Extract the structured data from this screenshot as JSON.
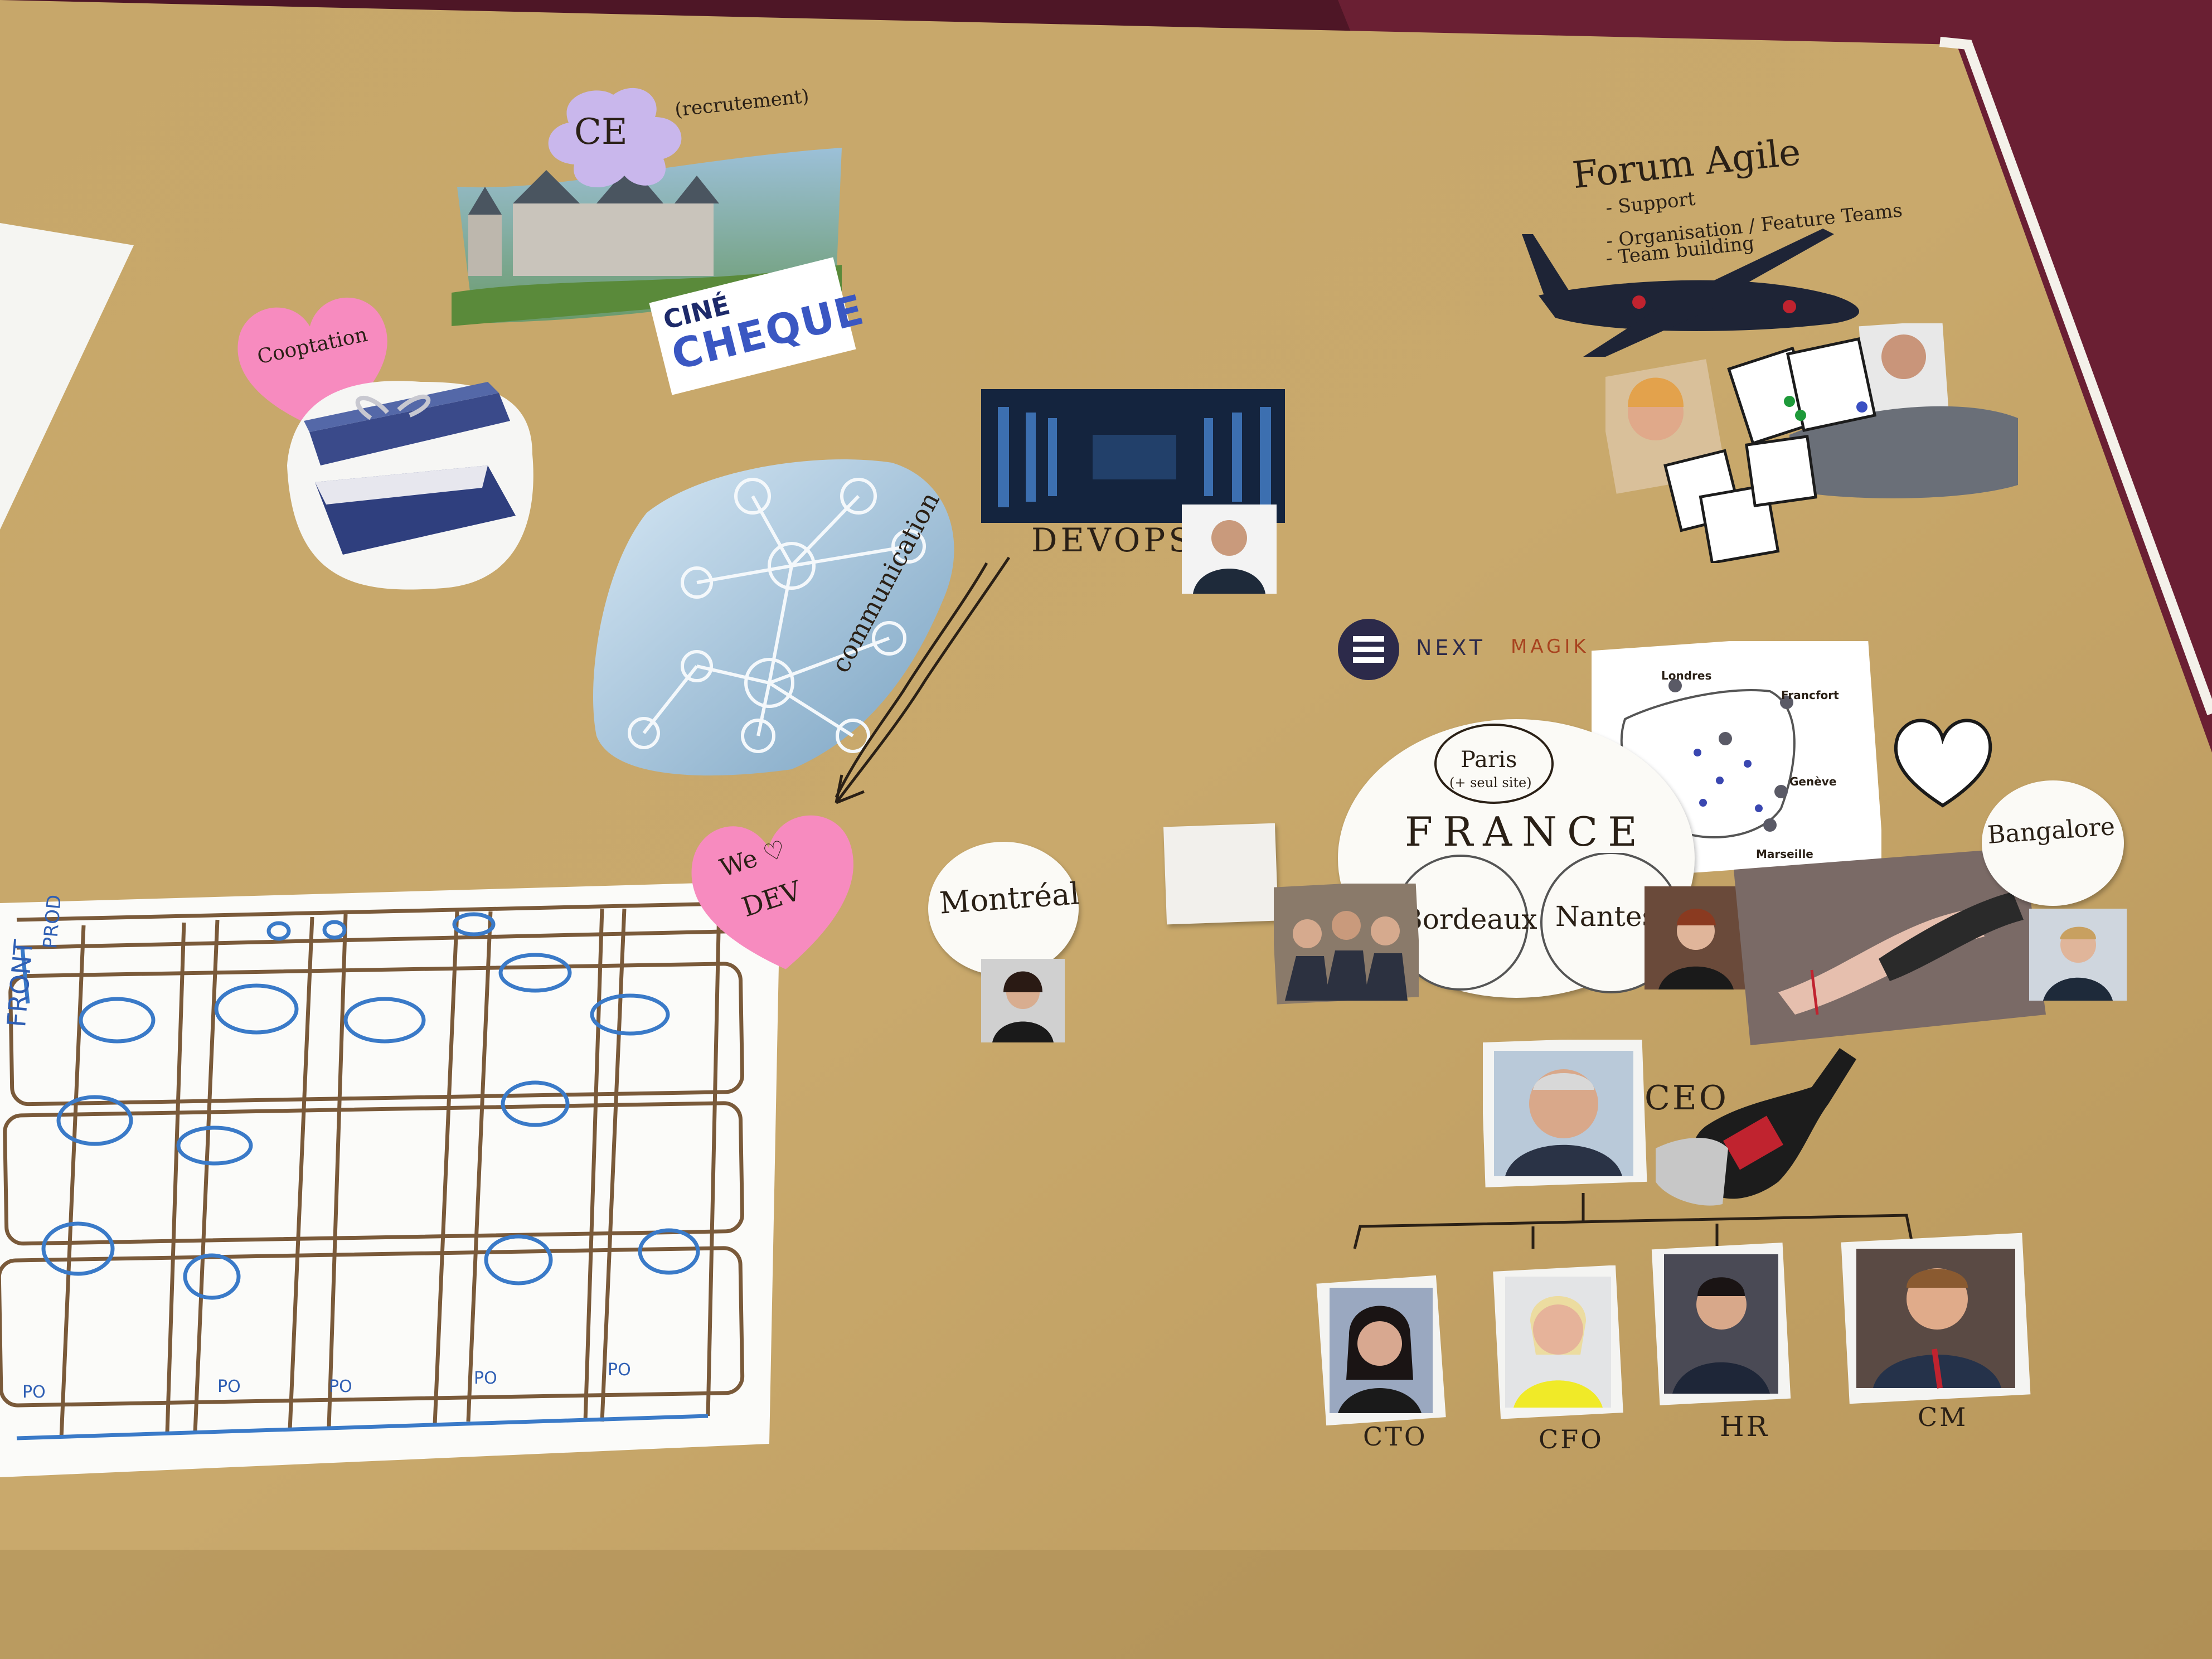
{
  "hr_board": {
    "ce": "CE",
    "ce_note": "(recrutement)",
    "cine_line1": "CINÉ",
    "cine_line2": "CHEQUE",
    "cooptation": "Cooptation",
    "communication": "communication",
    "we_love_dev_1": "We ♡",
    "we_love_dev_2": "DEV",
    "devops": "DEVOPS",
    "forum_title": "Forum Agile",
    "forum_items": [
      "- Support",
      "- Organisation / Feature Teams",
      "- Team building"
    ],
    "brand_next": "NEXT",
    "brand_magik": "MAGIK",
    "map_cities": [
      "Londres",
      "Francfort",
      "Genève",
      "Marseille"
    ],
    "paris": "Paris",
    "paris_note": "(+ seul site)",
    "france": "FRANCE",
    "bordeaux": "Bordeaux",
    "nantes": "Nantes",
    "montreal": "Montréal",
    "bangalore": "Bangalore",
    "ceo": "CEO",
    "cto": "CTO",
    "cfo": "CFO",
    "hr": "HR",
    "cm": "CM",
    "board_side_front": "FRONT",
    "board_side_prod": "PROD",
    "board_po": [
      "PO",
      "PO",
      "PO",
      "PO",
      "PO"
    ]
  },
  "colors": {
    "kraft": "#c8a86b",
    "carpet": "#5a1a2a",
    "pink_note": "#f78bbf",
    "lavender": "#c9b7ec",
    "brand": "#2c2a4a"
  }
}
